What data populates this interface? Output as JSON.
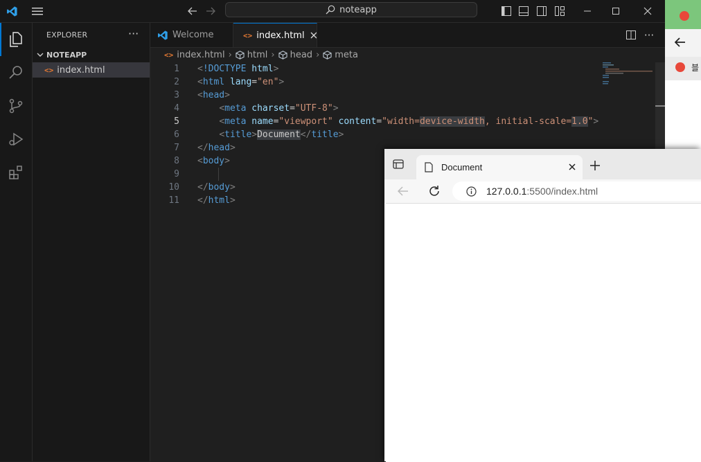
{
  "titlebar": {
    "search_text": "noteapp"
  },
  "sidebar": {
    "title": "EXPLORER",
    "more": "···",
    "folder": "NOTEAPP",
    "files": [
      {
        "name": "index.html"
      }
    ]
  },
  "tabs": [
    {
      "label": "Welcome",
      "active": false
    },
    {
      "label": "index.html",
      "active": true
    }
  ],
  "breadcrumb": [
    "index.html",
    "html",
    "head",
    "meta"
  ],
  "editor": {
    "current_line": 5,
    "lines": [
      {
        "n": "1"
      },
      {
        "n": "2"
      },
      {
        "n": "3"
      },
      {
        "n": "4"
      },
      {
        "n": "5"
      },
      {
        "n": "6"
      },
      {
        "n": "7"
      },
      {
        "n": "8"
      },
      {
        "n": "9"
      },
      {
        "n": "10"
      },
      {
        "n": "11"
      }
    ]
  },
  "browser": {
    "tab_title": "Document",
    "url_host": "127.0.0.1",
    "url_rest": ":5500/index.html"
  },
  "rightwin": {
    "text": "블"
  },
  "colors": {
    "accent": "#0078d4",
    "editor_bg": "#1f1f1f",
    "html_icon": "#e37933"
  }
}
